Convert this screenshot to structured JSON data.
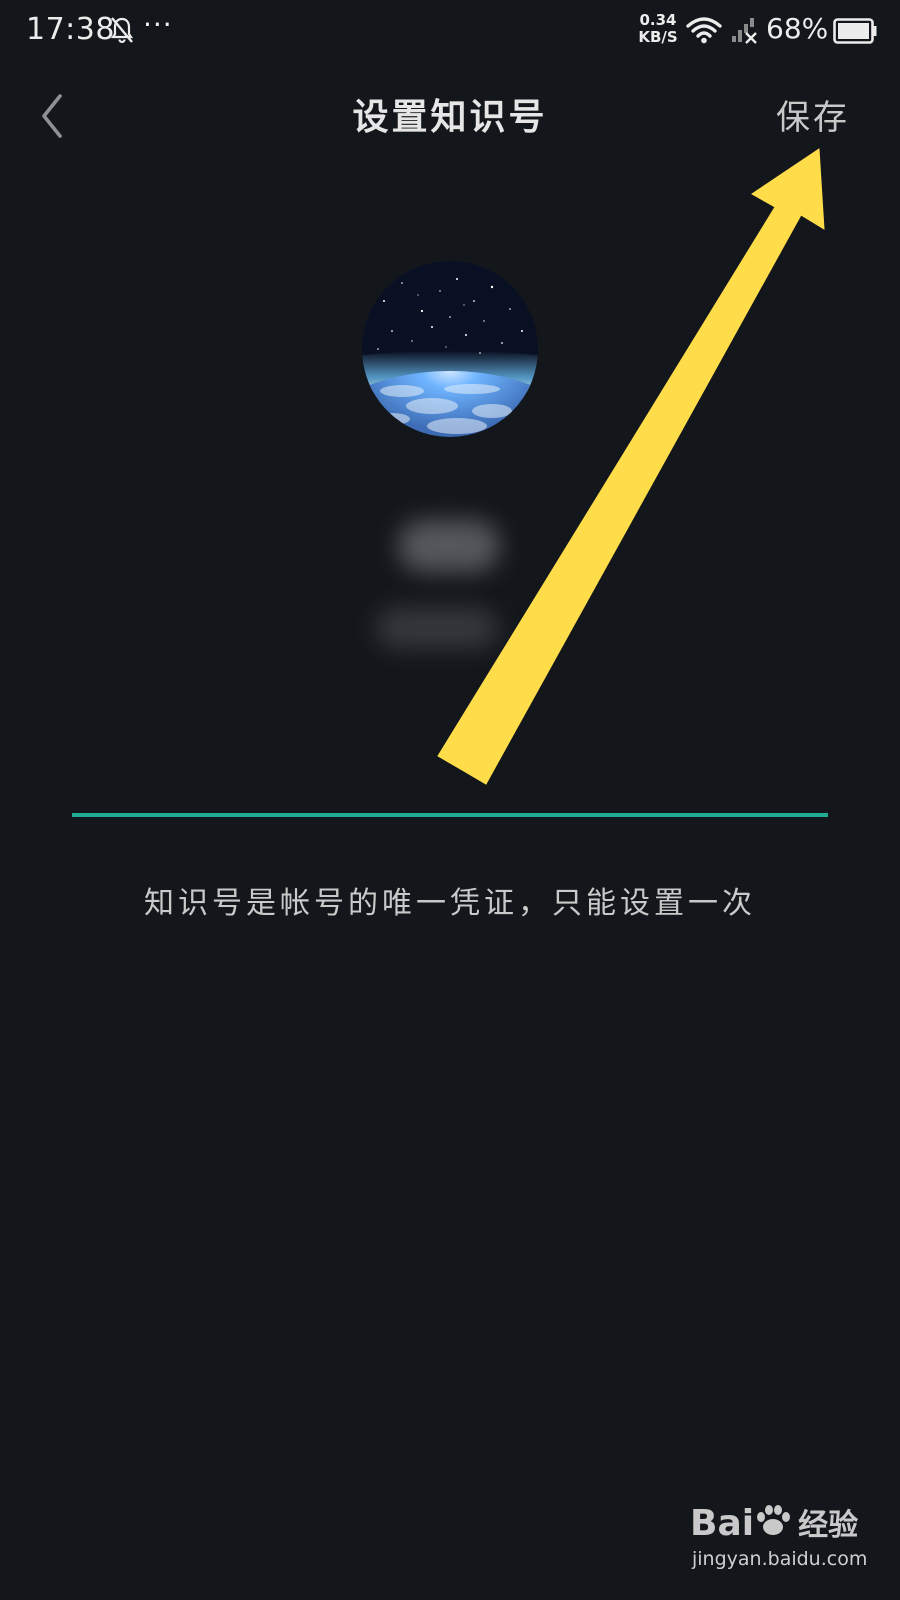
{
  "status_bar": {
    "time": "17:38",
    "dots": "···",
    "net_speed_value": "0.34",
    "net_speed_unit": "KB/S",
    "battery_percent": "68%",
    "icons": [
      "bell-muted-icon",
      "wifi-icon",
      "cellular-signal-icon",
      "battery-icon"
    ]
  },
  "header": {
    "back_icon": "chevron-left-icon",
    "title": "设置知识号",
    "save_label": "保存"
  },
  "form": {
    "input_value": "",
    "hint": "知识号是帐号的唯一凭证，只能设置一次"
  },
  "colors": {
    "background": "#13161b",
    "accent_underline": "#1fae93",
    "annotation_arrow": "#ffdd4a"
  },
  "watermark": {
    "brand_latin": "Bai",
    "brand_cn": "经验",
    "url": "jingyan.baidu.com"
  }
}
